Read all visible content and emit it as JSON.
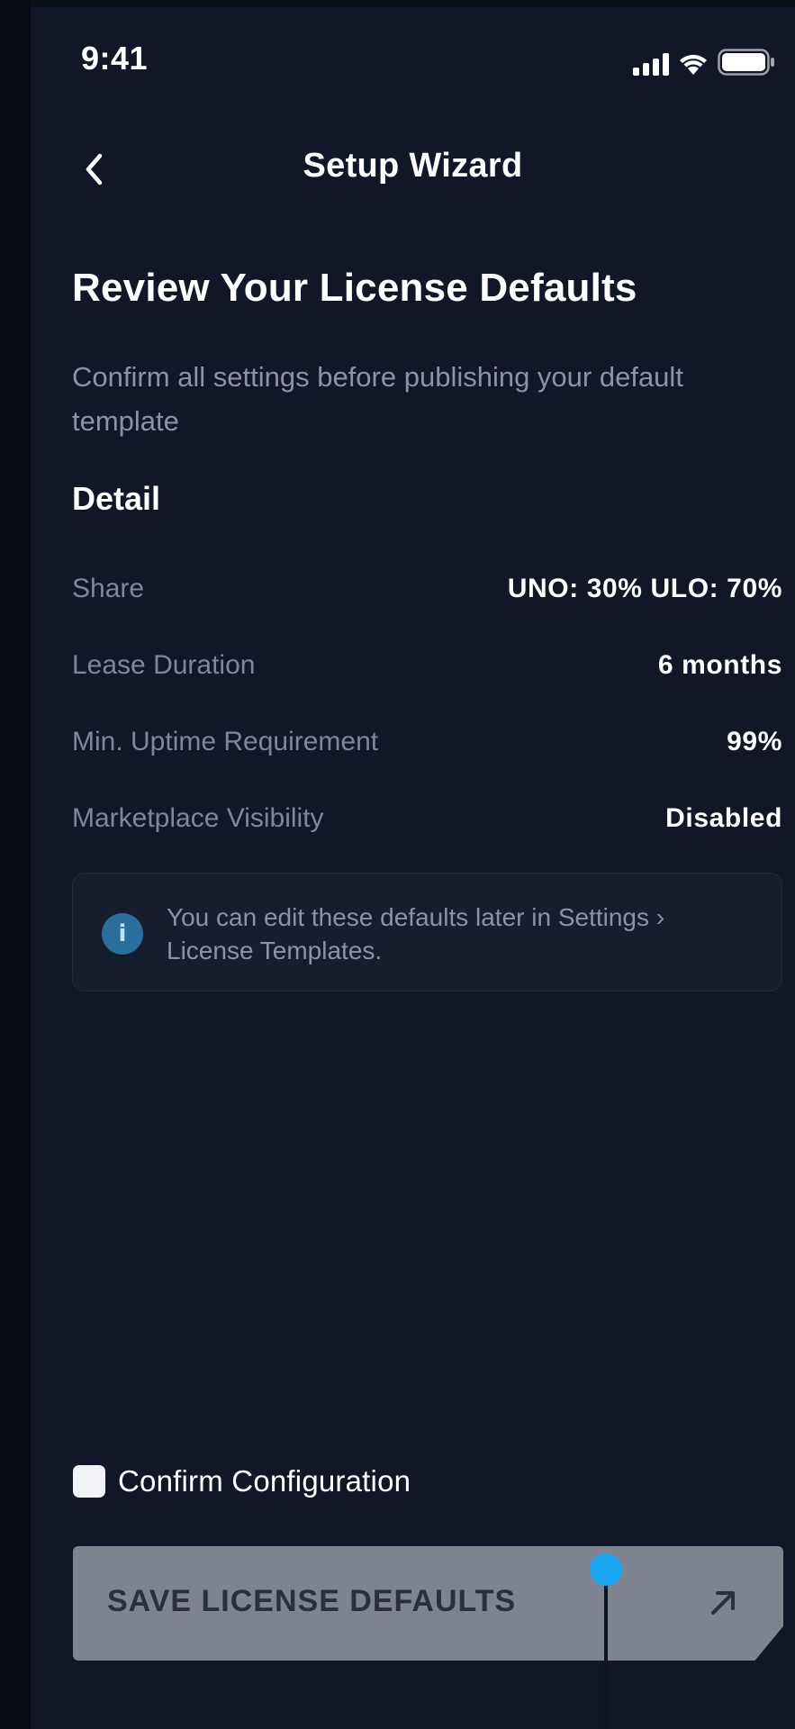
{
  "status_bar": {
    "time": "9:41",
    "icons": [
      "signal-icon",
      "wifi-icon",
      "battery-icon"
    ]
  },
  "header": {
    "back_icon": "chevron-left-icon",
    "title": "Setup Wizard"
  },
  "main": {
    "title": "Review Your License Defaults",
    "subtitle": "Confirm all settings before publishing your default template",
    "section_title": "Detail",
    "details": [
      {
        "label": "Share",
        "value": "UNO: 30% ULO: 70%"
      },
      {
        "label": "Lease Duration",
        "value": "6 months"
      },
      {
        "label": "Min. Uptime Requirement",
        "value": "99%"
      },
      {
        "label": "Marketplace Visibility",
        "value": "Disabled"
      }
    ],
    "info": {
      "icon": "info-icon",
      "icon_glyph": "i",
      "text": "You can edit these defaults later in Settings › License Templates."
    }
  },
  "footer": {
    "confirm_label": "Confirm Configuration",
    "confirm_checked": false,
    "save_label": "SAVE LICENSE DEFAULTS",
    "save_icon": "arrow-up-right-icon"
  },
  "colors": {
    "background": "#111729",
    "muted_text": "#8a93a8",
    "button_disabled": "#7e848f",
    "info_accent": "#2b6d9b",
    "touch_indicator": "#1aa6f0"
  }
}
